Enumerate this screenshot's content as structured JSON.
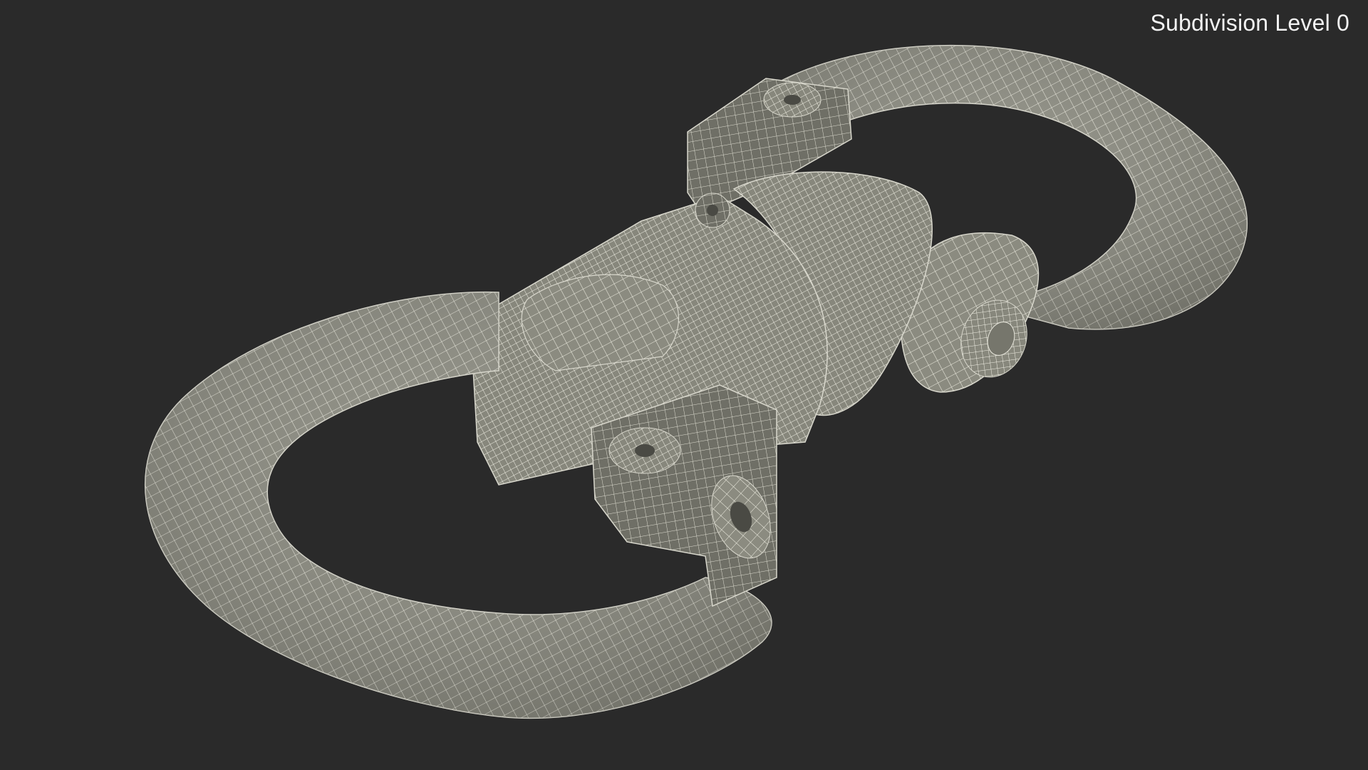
{
  "viewport": {
    "background": "#2a2a2a",
    "label": "Subdivision Level 0"
  },
  "model": {
    "subject": "swivel-lifting-shackle-wireframe",
    "surface_color": "#8d8d82",
    "wire_color": "#f2f1e6"
  }
}
